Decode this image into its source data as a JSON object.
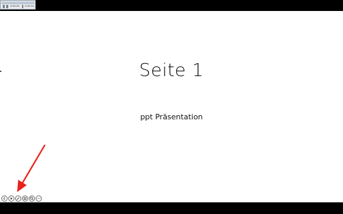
{
  "toolbar": {
    "time_left": "0:00:20",
    "time_right": "2:00:14"
  },
  "slide": {
    "title": "Seite 1",
    "subtitle": "ppt Präsentation"
  },
  "controls": [
    {
      "name": "previous-slide-button",
      "icon": "chevron-left-icon"
    },
    {
      "name": "next-slide-button",
      "icon": "play-icon"
    },
    {
      "name": "pen-tool-button",
      "icon": "pen-icon"
    },
    {
      "name": "see-all-slides-button",
      "icon": "grid-icon"
    },
    {
      "name": "zoom-button",
      "icon": "magnifier-icon"
    },
    {
      "name": "more-options-button",
      "icon": "ellipsis-icon"
    }
  ],
  "annotation": {
    "arrow_color": "#e8231c"
  }
}
